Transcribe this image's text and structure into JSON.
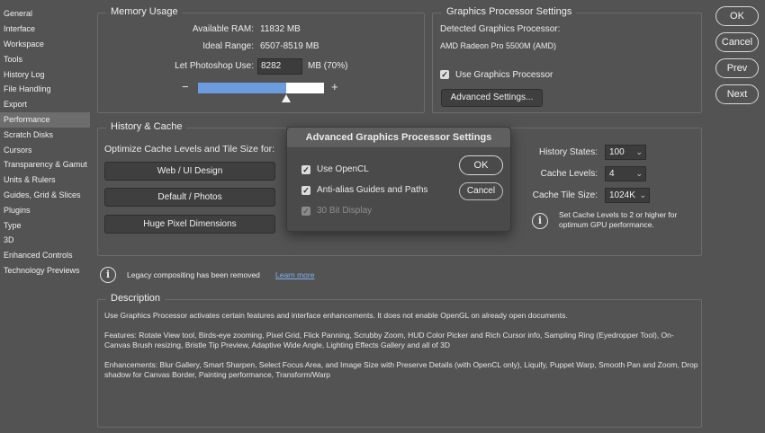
{
  "sidebar": {
    "items": [
      {
        "label": "General"
      },
      {
        "label": "Interface"
      },
      {
        "label": "Workspace"
      },
      {
        "label": "Tools"
      },
      {
        "label": "History Log"
      },
      {
        "label": "File Handling"
      },
      {
        "label": "Export"
      },
      {
        "label": "Performance"
      },
      {
        "label": "Scratch Disks"
      },
      {
        "label": "Cursors"
      },
      {
        "label": "Transparency & Gamut"
      },
      {
        "label": "Units & Rulers"
      },
      {
        "label": "Guides, Grid & Slices"
      },
      {
        "label": "Plugins"
      },
      {
        "label": "Type"
      },
      {
        "label": "3D"
      },
      {
        "label": "Enhanced Controls"
      },
      {
        "label": "Technology Previews"
      }
    ],
    "active": "Performance"
  },
  "memory": {
    "title": "Memory Usage",
    "available_label": "Available RAM:",
    "available_value": "11832 MB",
    "ideal_label": "Ideal Range:",
    "ideal_value": "6507-8519 MB",
    "let_label": "Let Photoshop Use:",
    "let_value": "8282",
    "let_unit": "MB (70%)",
    "minus": "−",
    "plus": "+",
    "slider_fraction": 0.7
  },
  "gpu": {
    "title": "Graphics Processor Settings",
    "detected_label": "Detected Graphics Processor:",
    "detected_value": "AMD Radeon Pro 5500M (AMD)",
    "use_label": "Use Graphics Processor",
    "advanced_button": "Advanced Settings..."
  },
  "actions": {
    "ok": "OK",
    "cancel": "Cancel",
    "prev": "Prev",
    "next": "Next"
  },
  "history": {
    "title": "History & Cache",
    "optimize_label": "Optimize Cache Levels and Tile Size for:",
    "web_button": "Web / UI Design",
    "default_button": "Default / Photos",
    "huge_button": "Huge Pixel Dimensions",
    "states_label": "History States:",
    "states_value": "100",
    "levels_label": "Cache Levels:",
    "levels_value": "4",
    "tile_label": "Cache Tile Size:",
    "tile_value": "1024K",
    "tip": "Set Cache Levels to 2 or higher for optimum GPU performance."
  },
  "legacy": {
    "text": "Legacy compositing has been removed",
    "link": "Learn more"
  },
  "description": {
    "title": "Description",
    "p1": "Use Graphics Processor activates certain features and interface enhancements. It does not enable OpenGL on already open documents.",
    "p2": "Features: Rotate View tool, Birds-eye zooming, Pixel Grid, Flick Panning, Scrubby Zoom, HUD Color Picker and Rich Cursor info, Sampling Ring (Eyedropper Tool), On-Canvas Brush resizing, Bristle Tip Preview, Adaptive Wide Angle, Lighting Effects Gallery and all of 3D",
    "p3": "Enhancements: Blur Gallery, Smart Sharpen, Select Focus Area, and Image Size with Preserve Details (with OpenCL only), Liquify, Puppet Warp, Smooth Pan and Zoom, Drop shadow for Canvas Border, Painting performance, Transform/Warp"
  },
  "modal": {
    "title": "Advanced Graphics Processor Settings",
    "opencl_label": "Use OpenCL",
    "antialias_label": "Anti-alias Guides and Paths",
    "bit30_label": "30 Bit Display",
    "ok": "OK",
    "cancel": "Cancel"
  },
  "colors": {
    "background": "#535353",
    "slider_fill": "#6c9bde",
    "link": "#7fb0ee"
  }
}
